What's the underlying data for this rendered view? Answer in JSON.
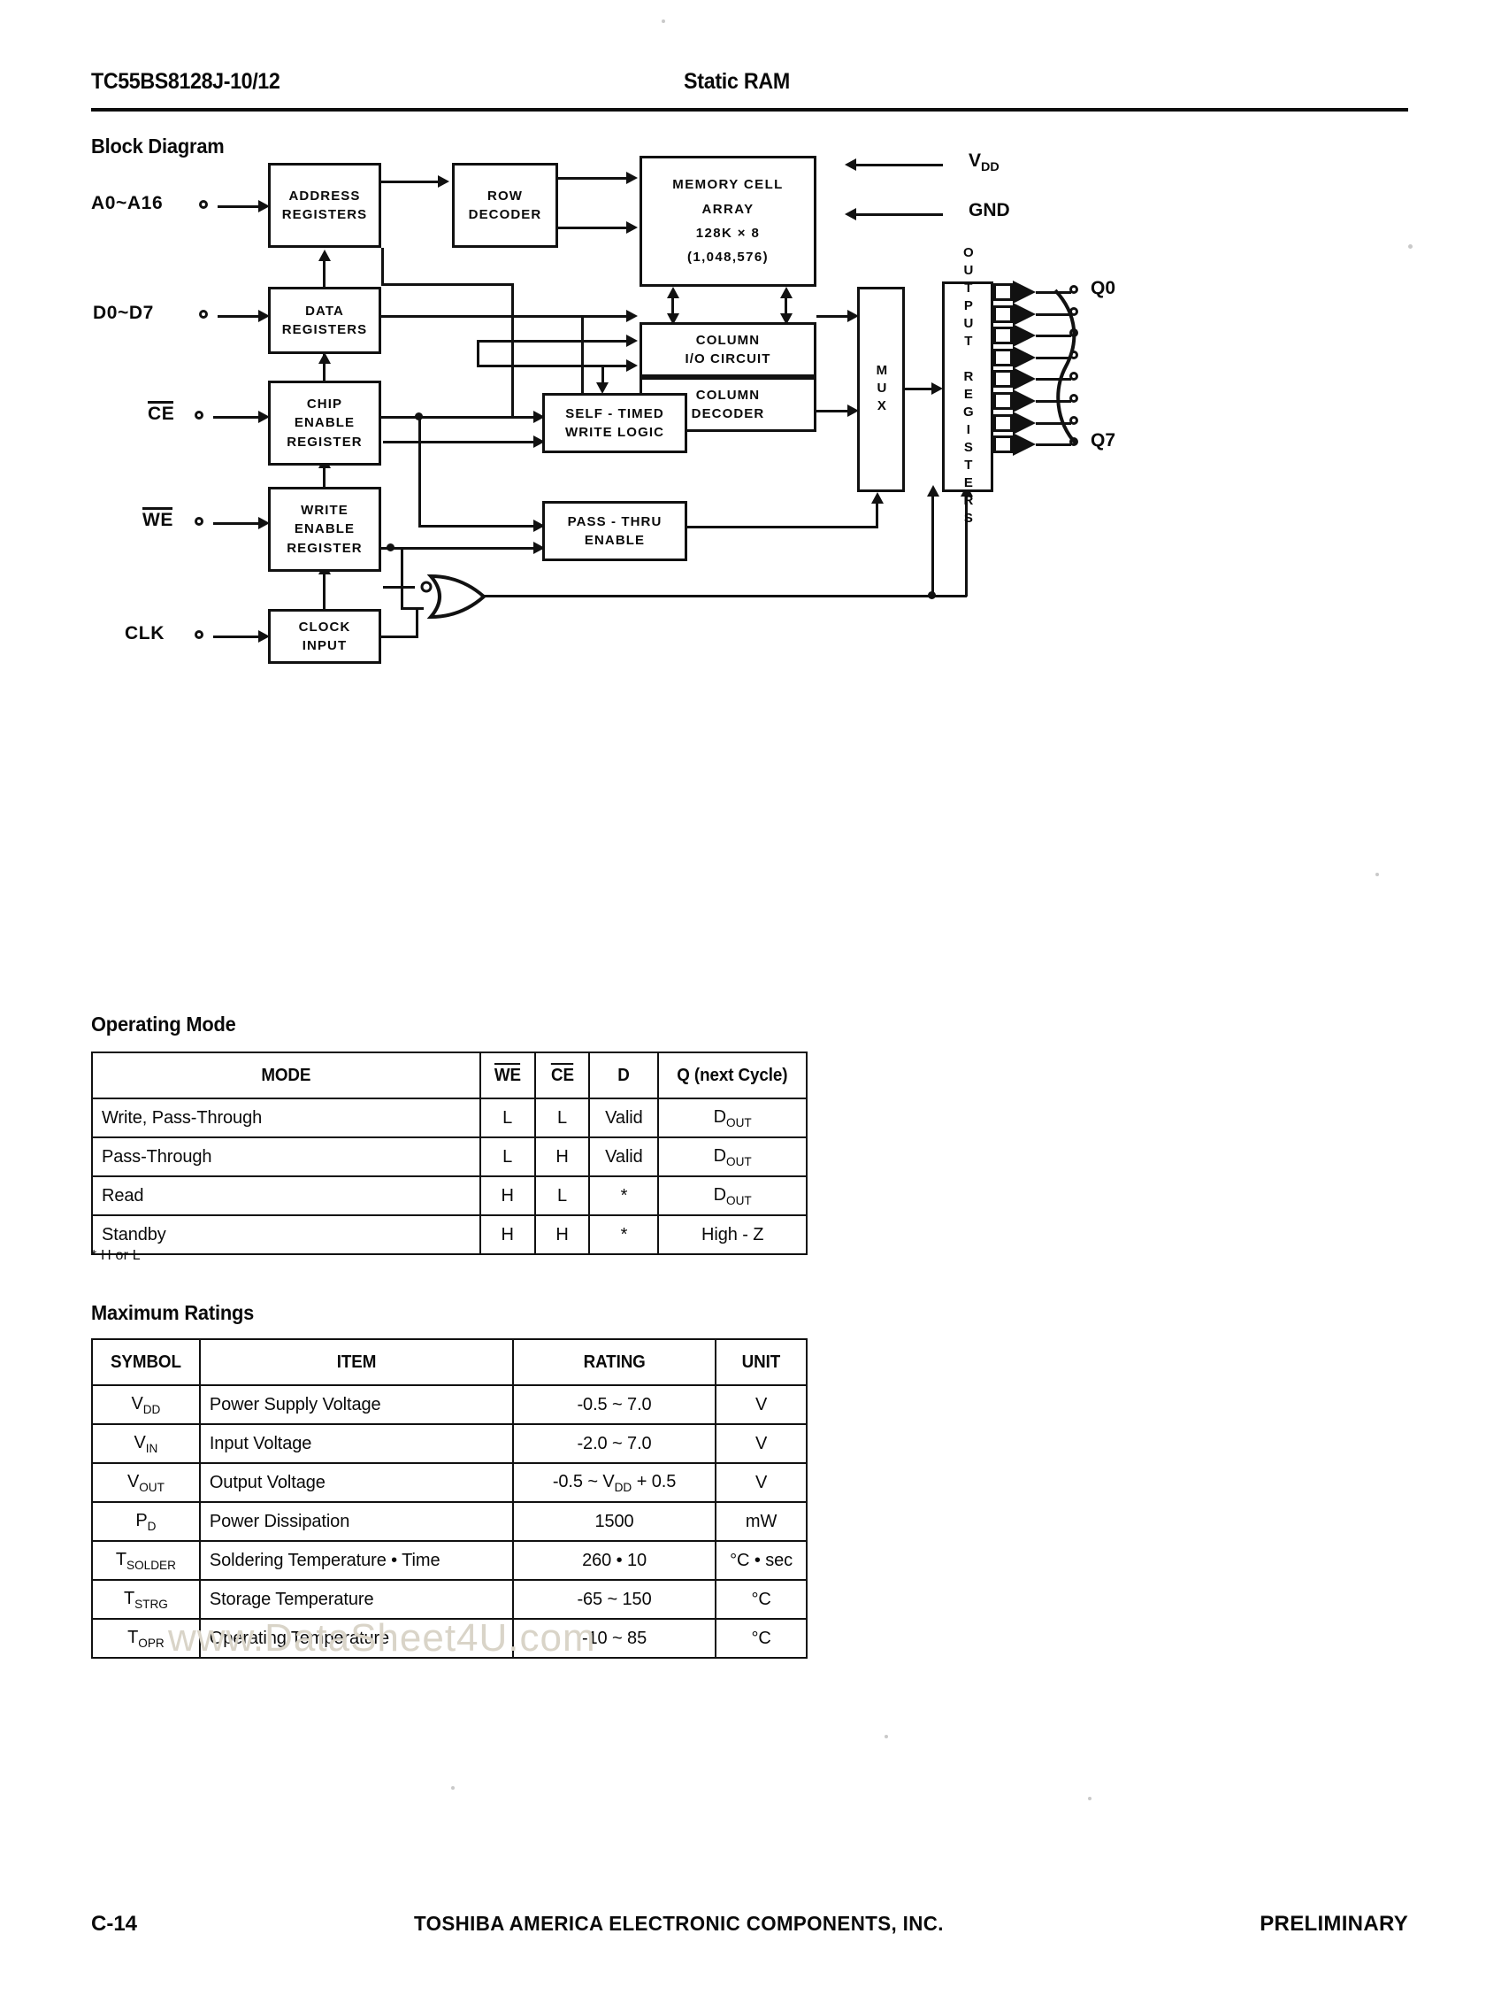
{
  "header": {
    "part_number": "TC55BS8128J-10/12",
    "device_type": "Static RAM"
  },
  "sections": {
    "block_diagram_title": "Block Diagram",
    "operating_mode_title": "Operating Mode",
    "maximum_ratings_title": "Maximum Ratings"
  },
  "block_diagram": {
    "inputs": [
      {
        "label": "A0~A16",
        "target": "ADDRESS REGISTERS"
      },
      {
        "label": "D0~D7",
        "target": "DATA REGISTERS"
      },
      {
        "label": "CE",
        "overbar": true,
        "target": "CHIP ENABLE REGISTER"
      },
      {
        "label": "WE",
        "overbar": true,
        "target": "WRITE ENABLE REGISTER"
      },
      {
        "label": "CLK",
        "target": "CLOCK INPUT"
      }
    ],
    "blocks": {
      "address_registers": [
        "ADDRESS",
        "REGISTERS"
      ],
      "row_decoder": [
        "ROW",
        "DECODER"
      ],
      "memory_cell_array": [
        "MEMORY CELL",
        "ARRAY",
        "128K × 8",
        "(1,048,576)"
      ],
      "data_registers": [
        "DATA",
        "REGISTERS"
      ],
      "column_io_circuit": [
        "COLUMN",
        "I/O CIRCUIT"
      ],
      "column_decoder": [
        "COLUMN",
        "DECODER"
      ],
      "chip_enable_register": [
        "CHIP",
        "ENABLE",
        "REGISTER"
      ],
      "self_timed_write_logic": [
        "SELF - TIMED",
        "WRITE LOGIC"
      ],
      "write_enable_register": [
        "WRITE",
        "ENABLE",
        "REGISTER"
      ],
      "pass_thru_enable": [
        "PASS - THRU",
        "ENABLE"
      ],
      "clock_input": [
        "CLOCK",
        "INPUT"
      ],
      "mux": "MUX",
      "output_registers": "OUTPUT REGISTERS"
    },
    "power_pins": [
      {
        "label": "V",
        "subscript": "DD"
      },
      {
        "label": "GND",
        "subscript": ""
      }
    ],
    "outputs": {
      "first": "Q0",
      "last": "Q7",
      "count": 8
    }
  },
  "operating_mode": {
    "columns": [
      "MODE",
      "WE",
      "CE",
      "D",
      "Q (next Cycle)"
    ],
    "column_overbars": [
      false,
      true,
      true,
      false,
      false
    ],
    "rows": [
      {
        "mode": "Write, Pass-Through",
        "we": "L",
        "ce": "L",
        "d": "Valid",
        "q": "D",
        "q_sub": "OUT"
      },
      {
        "mode": "Pass-Through",
        "we": "L",
        "ce": "H",
        "d": "Valid",
        "q": "D",
        "q_sub": "OUT"
      },
      {
        "mode": "Read",
        "we": "H",
        "ce": "L",
        "d": "*",
        "q": "D",
        "q_sub": "OUT"
      },
      {
        "mode": "Standby",
        "we": "H",
        "ce": "H",
        "d": "*",
        "q": "High - Z",
        "q_sub": ""
      }
    ],
    "footnote": "* H or L"
  },
  "maximum_ratings": {
    "columns": [
      "SYMBOL",
      "ITEM",
      "RATING",
      "UNIT"
    ],
    "rows": [
      {
        "symbol": "V",
        "symbol_sub": "DD",
        "item": "Power Supply Voltage",
        "rating": "-0.5 ~ 7.0",
        "rating_sub": "",
        "unit": "V",
        "unit_sub": ""
      },
      {
        "symbol": "V",
        "symbol_sub": "IN",
        "item": "Input Voltage",
        "rating": "-2.0 ~ 7.0",
        "rating_sub": "",
        "unit": "V",
        "unit_sub": ""
      },
      {
        "symbol": "V",
        "symbol_sub": "OUT",
        "item": "Output Voltage",
        "rating": "-0.5 ~ V",
        "rating_sub": "DD",
        "rating_tail": " + 0.5",
        "unit": "V",
        "unit_sub": ""
      },
      {
        "symbol": "P",
        "symbol_sub": "D",
        "item": "Power Dissipation",
        "rating": "1500",
        "rating_sub": "",
        "unit": "mW",
        "unit_sub": ""
      },
      {
        "symbol": "T",
        "symbol_sub": "SOLDER",
        "item": "Soldering Temperature • Time",
        "rating": "260 • 10",
        "rating_sub": "",
        "unit": "°C • sec",
        "unit_sub": ""
      },
      {
        "symbol": "T",
        "symbol_sub": "STRG",
        "item": "Storage Temperature",
        "rating": "-65 ~ 150",
        "rating_sub": "",
        "unit": "°C",
        "unit_sub": ""
      },
      {
        "symbol": "T",
        "symbol_sub": "OPR",
        "item": "Operating Temperature",
        "rating": "-10 ~ 85",
        "rating_sub": "",
        "unit": "°C",
        "unit_sub": ""
      }
    ]
  },
  "watermark": "www.DataSheet4U.com",
  "footer": {
    "page_number": "C-14",
    "company": "TOSHIBA AMERICA ELECTRONIC COMPONENTS, INC.",
    "status": "PRELIMINARY"
  }
}
